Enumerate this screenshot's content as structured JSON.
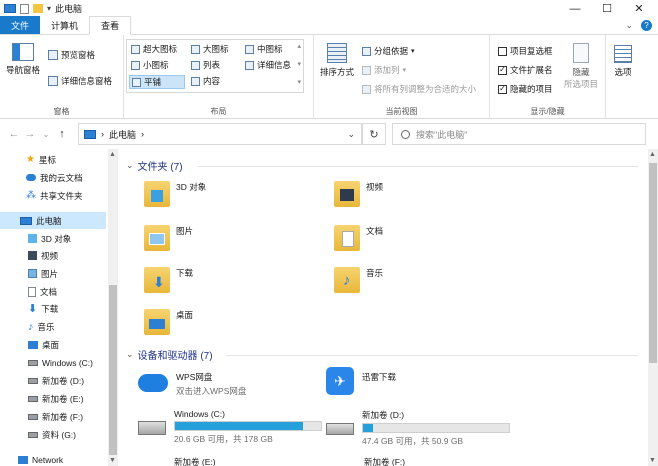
{
  "window": {
    "title": "此电脑",
    "minimize": "—",
    "maximize": "☐",
    "close": "✕"
  },
  "tabs": [
    {
      "label": "文件"
    },
    {
      "label": "计算机"
    },
    {
      "label": "查看"
    }
  ],
  "ribbon": {
    "panes": {
      "label": "窗格",
      "nav_pane": "导航窗格",
      "preview_pane": "预览窗格",
      "details_pane": "详细信息窗格"
    },
    "layout": {
      "label": "布局",
      "items": [
        "超大图标",
        "大图标",
        "中图标",
        "小图标",
        "列表",
        "详细信息",
        "平铺",
        "内容"
      ]
    },
    "current_view": {
      "label": "当前视图",
      "sort_by": "排序方式",
      "group_by": "分组依据",
      "add_column": "添加列",
      "fit_columns": "将所有列调整为合适的大小"
    },
    "show_hide": {
      "label": "显示/隐藏",
      "item_checkbox": "项目复选框",
      "file_ext": "文件扩展名",
      "hidden_items": "隐藏的项目",
      "hide": "隐藏",
      "selected_items": "所选项目",
      "options": "选项"
    }
  },
  "address": {
    "path": "此电脑",
    "separator": "›",
    "search_placeholder": "搜索\"此电脑\""
  },
  "sidebar": {
    "items": [
      {
        "label": "星标"
      },
      {
        "label": "我的云文档"
      },
      {
        "label": "共享文件夹"
      },
      {
        "label": "此电脑"
      },
      {
        "label": "3D 对象"
      },
      {
        "label": "视频"
      },
      {
        "label": "图片"
      },
      {
        "label": "文档"
      },
      {
        "label": "下载"
      },
      {
        "label": "音乐"
      },
      {
        "label": "桌面"
      },
      {
        "label": "Windows (C:)"
      },
      {
        "label": "新加卷 (D:)"
      },
      {
        "label": "新加卷 (E:)"
      },
      {
        "label": "新加卷 (F:)"
      },
      {
        "label": "资料 (G:)"
      },
      {
        "label": "Network"
      }
    ]
  },
  "main": {
    "folders_header": "文件夹 (7)",
    "folders": [
      {
        "label": "3D 对象"
      },
      {
        "label": "视频"
      },
      {
        "label": "图片"
      },
      {
        "label": "文档"
      },
      {
        "label": "下载"
      },
      {
        "label": "音乐"
      },
      {
        "label": "桌面"
      }
    ],
    "devices_header": "设备和驱动器 (7)",
    "apps": [
      {
        "name": "WPS网盘",
        "sub": "双击进入WPS网盘"
      },
      {
        "name": "迅雷下载",
        "sub": ""
      }
    ],
    "drives": [
      {
        "name": "Windows (C:)",
        "info": "20.6 GB 可用，共 178 GB",
        "used_fraction": 0.88
      },
      {
        "name": "新加卷 (D:)",
        "info": "47.4 GB 可用，共 50.9 GB",
        "used_fraction": 0.07
      },
      {
        "name": "新加卷 (E:)"
      },
      {
        "name": "新加卷 (F:)"
      }
    ]
  }
}
